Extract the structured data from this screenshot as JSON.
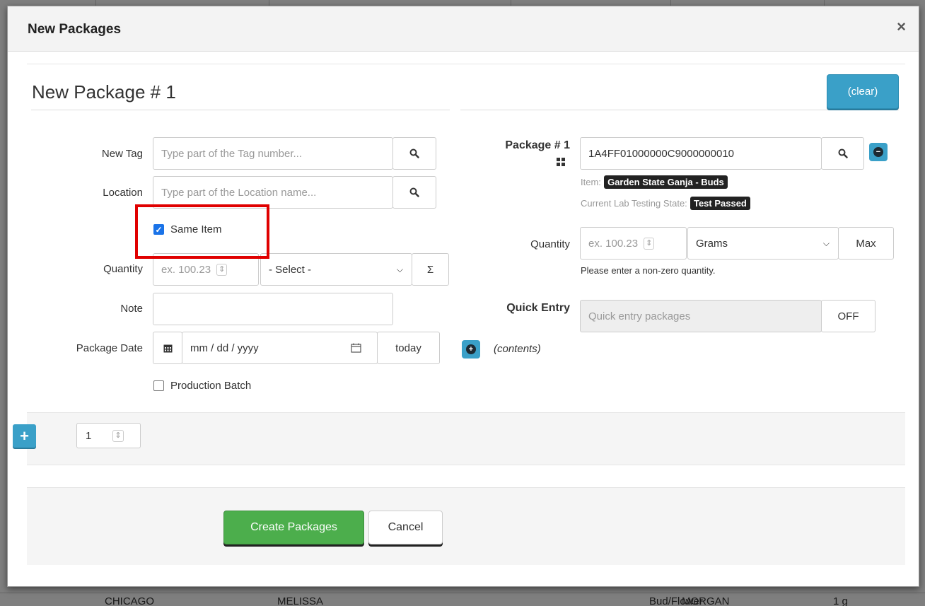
{
  "background": {
    "row_cells": [
      "CHICAGO",
      "MELISSA",
      "Bud/Flower",
      "MORGAN",
      "1 g"
    ]
  },
  "modal": {
    "title": "New Packages",
    "close_glyph": "×"
  },
  "panel": {
    "title": "New Package # 1",
    "clear_label": "(clear)"
  },
  "left": {
    "new_tag_label": "New Tag",
    "new_tag_placeholder": "Type part of the Tag number...",
    "location_label": "Location",
    "location_placeholder": "Type part of the Location name...",
    "same_item_label": "Same Item",
    "same_item_checked": true,
    "quantity_label": "Quantity",
    "quantity_placeholder": "ex. 100.23",
    "unit_select_value": "- Select -",
    "sum_glyph": "Σ",
    "note_label": "Note",
    "note_value": "",
    "package_date_label": "Package Date",
    "package_date_placeholder": "mm / dd / yyyy",
    "today_label": "today",
    "production_batch_label": "Production Batch",
    "production_batch_checked": false
  },
  "right": {
    "package_label": "Package # 1",
    "package_value": "1A4FF01000000C9000000010",
    "item_label": "Item:",
    "item_value": "Garden State Ganja - Buds",
    "lab_state_label": "Current Lab Testing State:",
    "lab_state_value": "Test Passed",
    "quantity_label": "Quantity",
    "quantity_placeholder": "ex. 100.23",
    "unit_select_value": "Grams",
    "max_label": "Max",
    "quantity_hint": "Please enter a non-zero quantity.",
    "quick_entry_label": "Quick Entry",
    "quick_entry_placeholder": "Quick entry packages",
    "quick_entry_toggle": "OFF",
    "contents_label": "(contents)"
  },
  "footer": {
    "package_count": "1",
    "create_label": "Create Packages",
    "cancel_label": "Cancel"
  },
  "colors": {
    "accent_blue": "#3aa0c8",
    "success_green": "#4cae4c",
    "highlight_red": "#e00000"
  },
  "icons": [
    "search-icon",
    "minus-circle-icon",
    "grid-icon",
    "calendar-icon",
    "plus-circle-icon",
    "plus-icon",
    "spinner-icon",
    "chevron-down-icon",
    "close-icon"
  ]
}
